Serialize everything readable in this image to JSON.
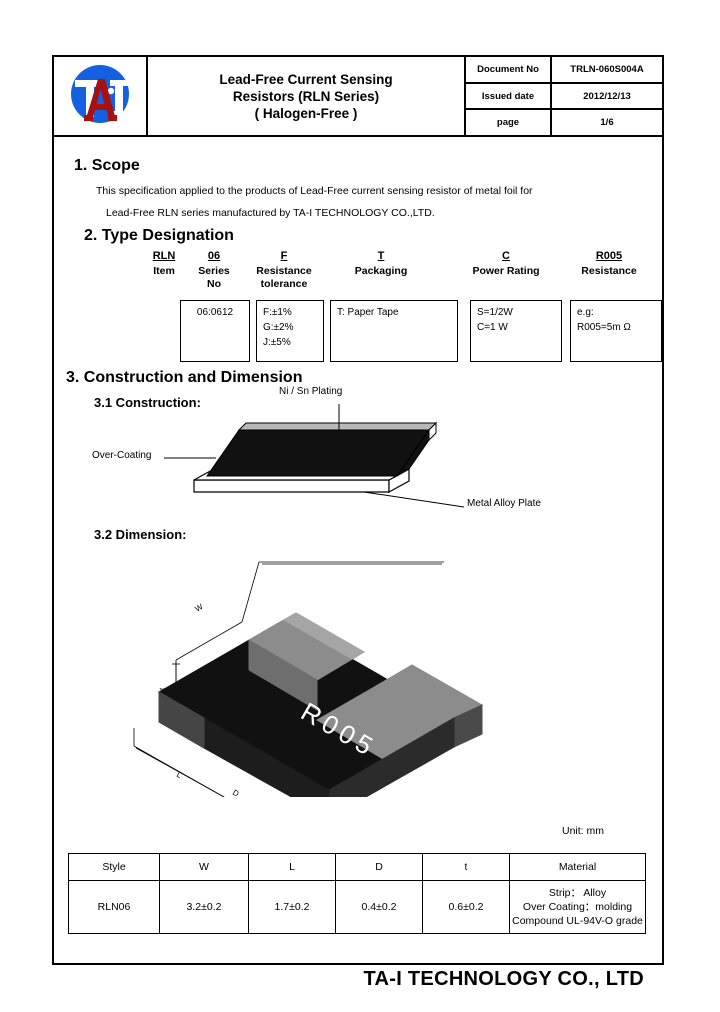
{
  "header": {
    "logo_alt": "TA-I logo",
    "title_lines": [
      "Lead-Free Current Sensing",
      "Resistors (RLN Series)",
      "( Halogen-Free )"
    ],
    "meta": [
      {
        "label": "Document No",
        "value": "TRLN-060S004A"
      },
      {
        "label": "Issued date",
        "value": "2012/12/13"
      },
      {
        "label": "page",
        "value": "1/6"
      }
    ]
  },
  "scope": {
    "heading": "1. Scope",
    "line1": "This specification applied to the products of Lead-Free current sensing resistor of metal foil for",
    "line2": "Lead-Free RLN series manufactured by TA-I TECHNOLOGY CO.,LTD."
  },
  "type_designation": {
    "heading": "2. Type Designation",
    "columns": [
      {
        "code": "RLN",
        "label": "Item"
      },
      {
        "code": "06",
        "label": "Series\nNo"
      },
      {
        "code": "F",
        "label": "Resistance\ntolerance"
      },
      {
        "code": "T",
        "label": "Packaging"
      },
      {
        "code": "C",
        "label": "Power Rating"
      },
      {
        "code": "R005",
        "label": "Resistance"
      }
    ],
    "boxes": [
      {
        "text": "06:0612"
      },
      {
        "text": "F:±1%\nG:±2%\nJ:±5%"
      },
      {
        "text": "T: Paper Tape"
      },
      {
        "text": "S=1/2W\n  C=1 W"
      },
      {
        "text": "e.g:\nR005=5m Ω"
      }
    ]
  },
  "construction": {
    "heading": "3. Construction and Dimension",
    "sub1": "3.1 Construction:",
    "sub2": "3.2 Dimension:",
    "labels": {
      "plating": "Ni / Sn Plating",
      "overcoating": "Over-Coating",
      "metal_plate": "Metal Alloy Plate"
    },
    "chip_marking": "R005",
    "dimension_letters": {
      "w": "W",
      "l": "L",
      "d": "D",
      "t": "t"
    },
    "unit_note": "Unit: mm"
  },
  "dimension_table": {
    "headers": [
      "Style",
      "W",
      "L",
      "D",
      "t",
      "Material"
    ],
    "rows": [
      {
        "style": "RLN06",
        "w": "3.2±0.2",
        "l": "1.7±0.2",
        "d": "0.4±0.2",
        "t": "0.6±0.2",
        "material": "Strip： Alloy\nOver Coating：molding\nCompound UL-94V-O grade"
      }
    ]
  },
  "footer": {
    "company": "TA-I TECHNOLOGY CO., LTD"
  },
  "colors": {
    "logo_blue": "#1560e0",
    "logo_red": "#a81010",
    "chip_body": "#111111",
    "chip_terminal": "#8c8c8c",
    "chip_terminal_dark": "#4a4a4a",
    "plating_gray": "#b8b8b8"
  }
}
